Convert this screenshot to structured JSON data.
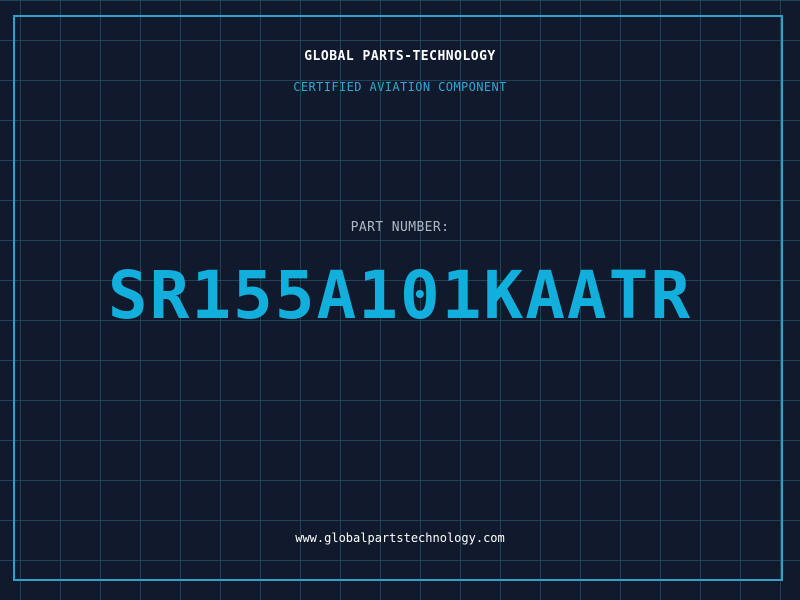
{
  "header": {
    "company_name": "GLOBAL PARTS-TECHNOLOGY",
    "subtitle": "CERTIFIED AVIATION COMPONENT"
  },
  "part": {
    "label": "PART NUMBER:",
    "number": "SR155A101KAATR"
  },
  "footer": {
    "website": "www.globalpartstechnology.com"
  },
  "colors": {
    "background": "#111a2d",
    "grid": "#24647d",
    "frame": "#2fa0c8",
    "accent": "#12aedc",
    "subtitle": "#2fa7d2",
    "label": "#aeb8c6",
    "text": "#ffffff"
  }
}
